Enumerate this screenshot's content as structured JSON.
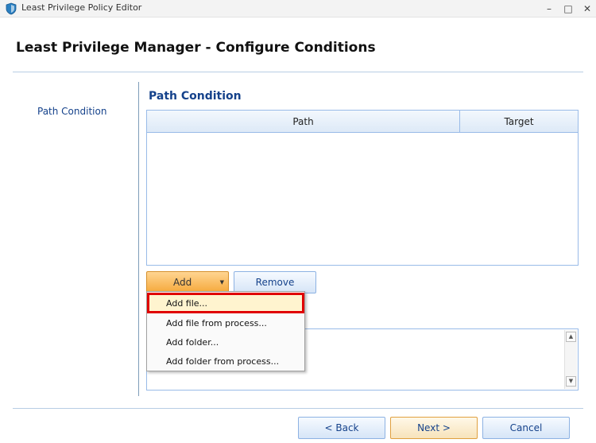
{
  "window": {
    "title": "Least Privilege Policy Editor",
    "minimize": "–",
    "maximize": "□",
    "close": "✕"
  },
  "header": {
    "title": "Least Privilege Manager - Configure Conditions"
  },
  "nav": {
    "items": [
      "Path Condition"
    ]
  },
  "section": {
    "title": "Path Condition"
  },
  "grid": {
    "columns": [
      "Path",
      "Target"
    ],
    "rows": []
  },
  "buttons": {
    "add": "Add",
    "remove": "Remove",
    "back": "<  Back",
    "next": "Next  >",
    "cancel": "Cancel"
  },
  "add_menu": {
    "items": [
      "Add file...",
      "Add file from process...",
      "Add folder...",
      "Add folder from process..."
    ],
    "highlighted_index": 0
  },
  "icons": {
    "app": "shield-icon",
    "caret": "caret-down-icon",
    "scroll_up": "scroll-up-icon",
    "scroll_down": "scroll-down-icon"
  },
  "colors": {
    "accent": "#15428b",
    "highlight_border": "#e00000",
    "add_button": "#f5a83a"
  }
}
